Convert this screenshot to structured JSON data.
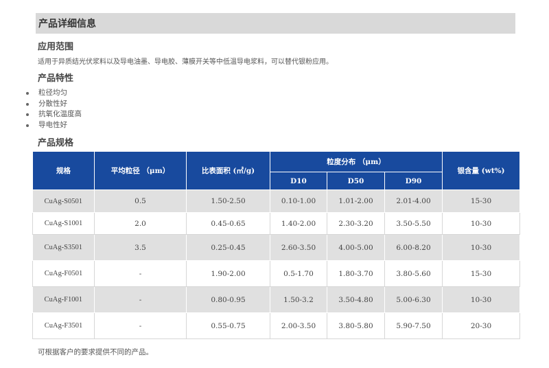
{
  "page_title": "产品详细信息",
  "application": {
    "heading": "应用范围",
    "text": "适用于异质结光伏浆料以及导电油墨、导电胶、薄膜开关等中低温导电浆料，可以替代银粉应用。"
  },
  "features": {
    "heading": "产品特性",
    "items": [
      "粒径均匀",
      "分散性好",
      "抗氧化温度高",
      "导电性好"
    ]
  },
  "specs": {
    "heading": "产品规格",
    "headers": {
      "model": "规格",
      "avg_size": "平均粒径 （μm）",
      "surface_area": "比表面积 (㎡/g)",
      "distribution": "粒度分布 （μm）",
      "d10": "D10",
      "d50": "D50",
      "d90": "D90",
      "silver": "银含量 (wt%)"
    },
    "rows": [
      [
        "CuAg-S0501",
        "0.5",
        "1.50-2.50",
        "0.10-1.00",
        "1.01-2.00",
        "2.01-4.00",
        "15-30"
      ],
      [
        "CuAg-S1001",
        "2.0",
        "0.45-0.65",
        "1.40-2.00",
        "2.30-3.20",
        "3.50-5.50",
        "10-30"
      ],
      [
        "CuAg-S3501",
        "3.5",
        "0.25-0.45",
        "2.60-3.50",
        "4.00-5.00",
        "6.00-8.20",
        "10-30"
      ],
      [
        "CuAg-F0501",
        "-",
        "1.90-2.00",
        "0.5-1.70",
        "1.80-3.70",
        "3.80-5.60",
        "15-30"
      ],
      [
        "CuAg-F1001",
        "-",
        "0.80-0.95",
        "1.50-3.2",
        "3.50-4.80",
        "5.00-6.30",
        "10-30"
      ],
      [
        "CuAg-F3501",
        "-",
        "0.55-0.75",
        "2.00-3.50",
        "3.80-5.80",
        "5.90-7.50",
        "20-30"
      ]
    ]
  },
  "footnote": "可根据客户的要求提供不同的产品。"
}
